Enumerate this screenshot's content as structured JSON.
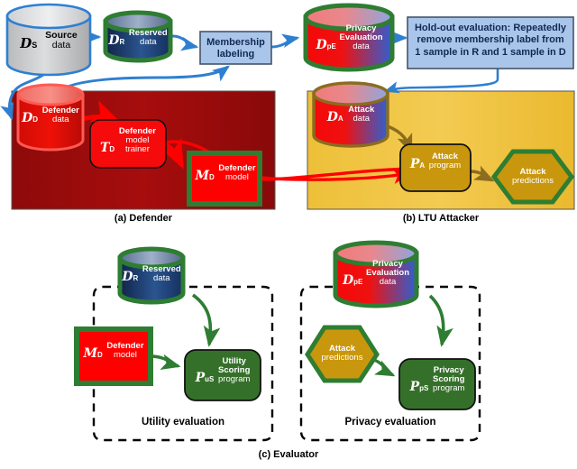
{
  "figure": {
    "panels": [
      {
        "id": "a",
        "caption": "(a)  Defender",
        "fill": "#9e0b0b"
      },
      {
        "id": "b",
        "caption": "(b) LTU Attacker",
        "fill": "#efc13c"
      },
      {
        "id": "c",
        "caption": "(c) Evaluator"
      }
    ],
    "dashed_groups": [
      {
        "id": "utility",
        "caption": "Utility evaluation"
      },
      {
        "id": "privacy",
        "caption": "Privacy evaluation"
      }
    ]
  },
  "nodes": {
    "source_data": {
      "symbol": "D",
      "sub": "S",
      "title": "Source",
      "subtitle": "data",
      "shape": "cylinder",
      "fill": "#c9cacc",
      "stroke": "#2f7fd1",
      "text_color": "#000000"
    },
    "reserved_data": {
      "symbol": "D",
      "sub": "R",
      "title": "Reserved",
      "subtitle": "data",
      "shape": "cylinder",
      "fill": "#1f3f72",
      "stroke": "#2e7d32",
      "text_color": "#ffffff"
    },
    "membership_labeling": {
      "line1": "Membership",
      "line2": "labeling",
      "shape": "rect",
      "fill": "#a9c6ea",
      "stroke": "#44546a"
    },
    "privacy_eval_data_top": {
      "symbol": "D",
      "sub": "pE",
      "title": "Privacy",
      "subtitle": "Evaluation",
      "subtitle2": "data",
      "shape": "cylinder",
      "stroke": "#2e7d32"
    },
    "holdout_note": {
      "line1": "Hold-out evaluation: Repeatedly",
      "line2": "remove membership label from",
      "line3": "1 sample in R and 1 sample in D",
      "shape": "rect",
      "fill": "#a9c6ea",
      "stroke": "#44546a"
    },
    "defender_data": {
      "symbol": "D",
      "sub": "D",
      "title": "Defender",
      "subtitle": "data",
      "shape": "cylinder",
      "fill": "#e8170f",
      "stroke": "#ff5a52"
    },
    "defender_trainer": {
      "symbol": "T",
      "sub": "D",
      "title": "Defender",
      "subtitle": "model",
      "subtitle2": "trainer",
      "shape": "roundrect",
      "fill": "#f50b0b",
      "stroke": "#111111"
    },
    "defender_model": {
      "symbol": "M",
      "sub": "D",
      "title": "Defender",
      "subtitle": "model",
      "shape": "rect",
      "fill": "#fe0000",
      "stroke": "#2e7d32"
    },
    "attack_data": {
      "symbol": "D",
      "sub": "A",
      "title": "Attack",
      "subtitle": "data",
      "shape": "cylinder",
      "stroke": "#8a6d1f"
    },
    "attack_program": {
      "symbol": "P",
      "sub": "A",
      "title": "Attack",
      "subtitle": "program",
      "shape": "roundrect",
      "fill": "#c9970d",
      "stroke": "#111111"
    },
    "attack_predictions": {
      "title": "Attack",
      "subtitle": "predictions",
      "shape": "hexagon",
      "fill": "#c9970d",
      "stroke": "#2e7d32"
    },
    "reserved_data_eval": {
      "symbol": "D",
      "sub": "R",
      "title": "Reserved",
      "subtitle": "data",
      "shape": "cylinder",
      "fill": "#1f3f72",
      "stroke": "#2e7d32"
    },
    "defender_model_eval": {
      "symbol": "M",
      "sub": "D",
      "title": "Defender",
      "subtitle": "model",
      "shape": "rect",
      "fill": "#fe0000",
      "stroke": "#2e7d32"
    },
    "utility_scoring": {
      "symbol": "P",
      "sub": "uS",
      "title": "Utility",
      "subtitle": "Scoring",
      "subtitle2": "program",
      "shape": "roundrect",
      "fill": "#35702a",
      "stroke": "#111111"
    },
    "privacy_eval_data_bottom": {
      "symbol": "D",
      "sub": "pE",
      "title": "Privacy",
      "subtitle": "Evaluation",
      "subtitle2": "data",
      "shape": "cylinder",
      "stroke": "#2e7d32"
    },
    "attack_predictions_eval": {
      "title": "Attack",
      "subtitle": "predictions",
      "shape": "hexagon",
      "fill": "#c9970d",
      "stroke": "#2e7d32"
    },
    "privacy_scoring": {
      "symbol": "P",
      "sub": "pS",
      "title": "Privacy",
      "subtitle": "Scoring",
      "subtitle2": "program",
      "shape": "roundrect",
      "fill": "#35702a",
      "stroke": "#111111"
    }
  },
  "colors": {
    "blue_arrow": "#2f7fd1",
    "red_arrow": "#fe0000",
    "olive_arrow": "#8a6d1f",
    "green_arrow": "#2e7d32",
    "defender_panel": "#9e0b0b",
    "attacker_panel": "#efc13c",
    "green_border": "#2e7d32",
    "dashed_border": "#000000"
  }
}
